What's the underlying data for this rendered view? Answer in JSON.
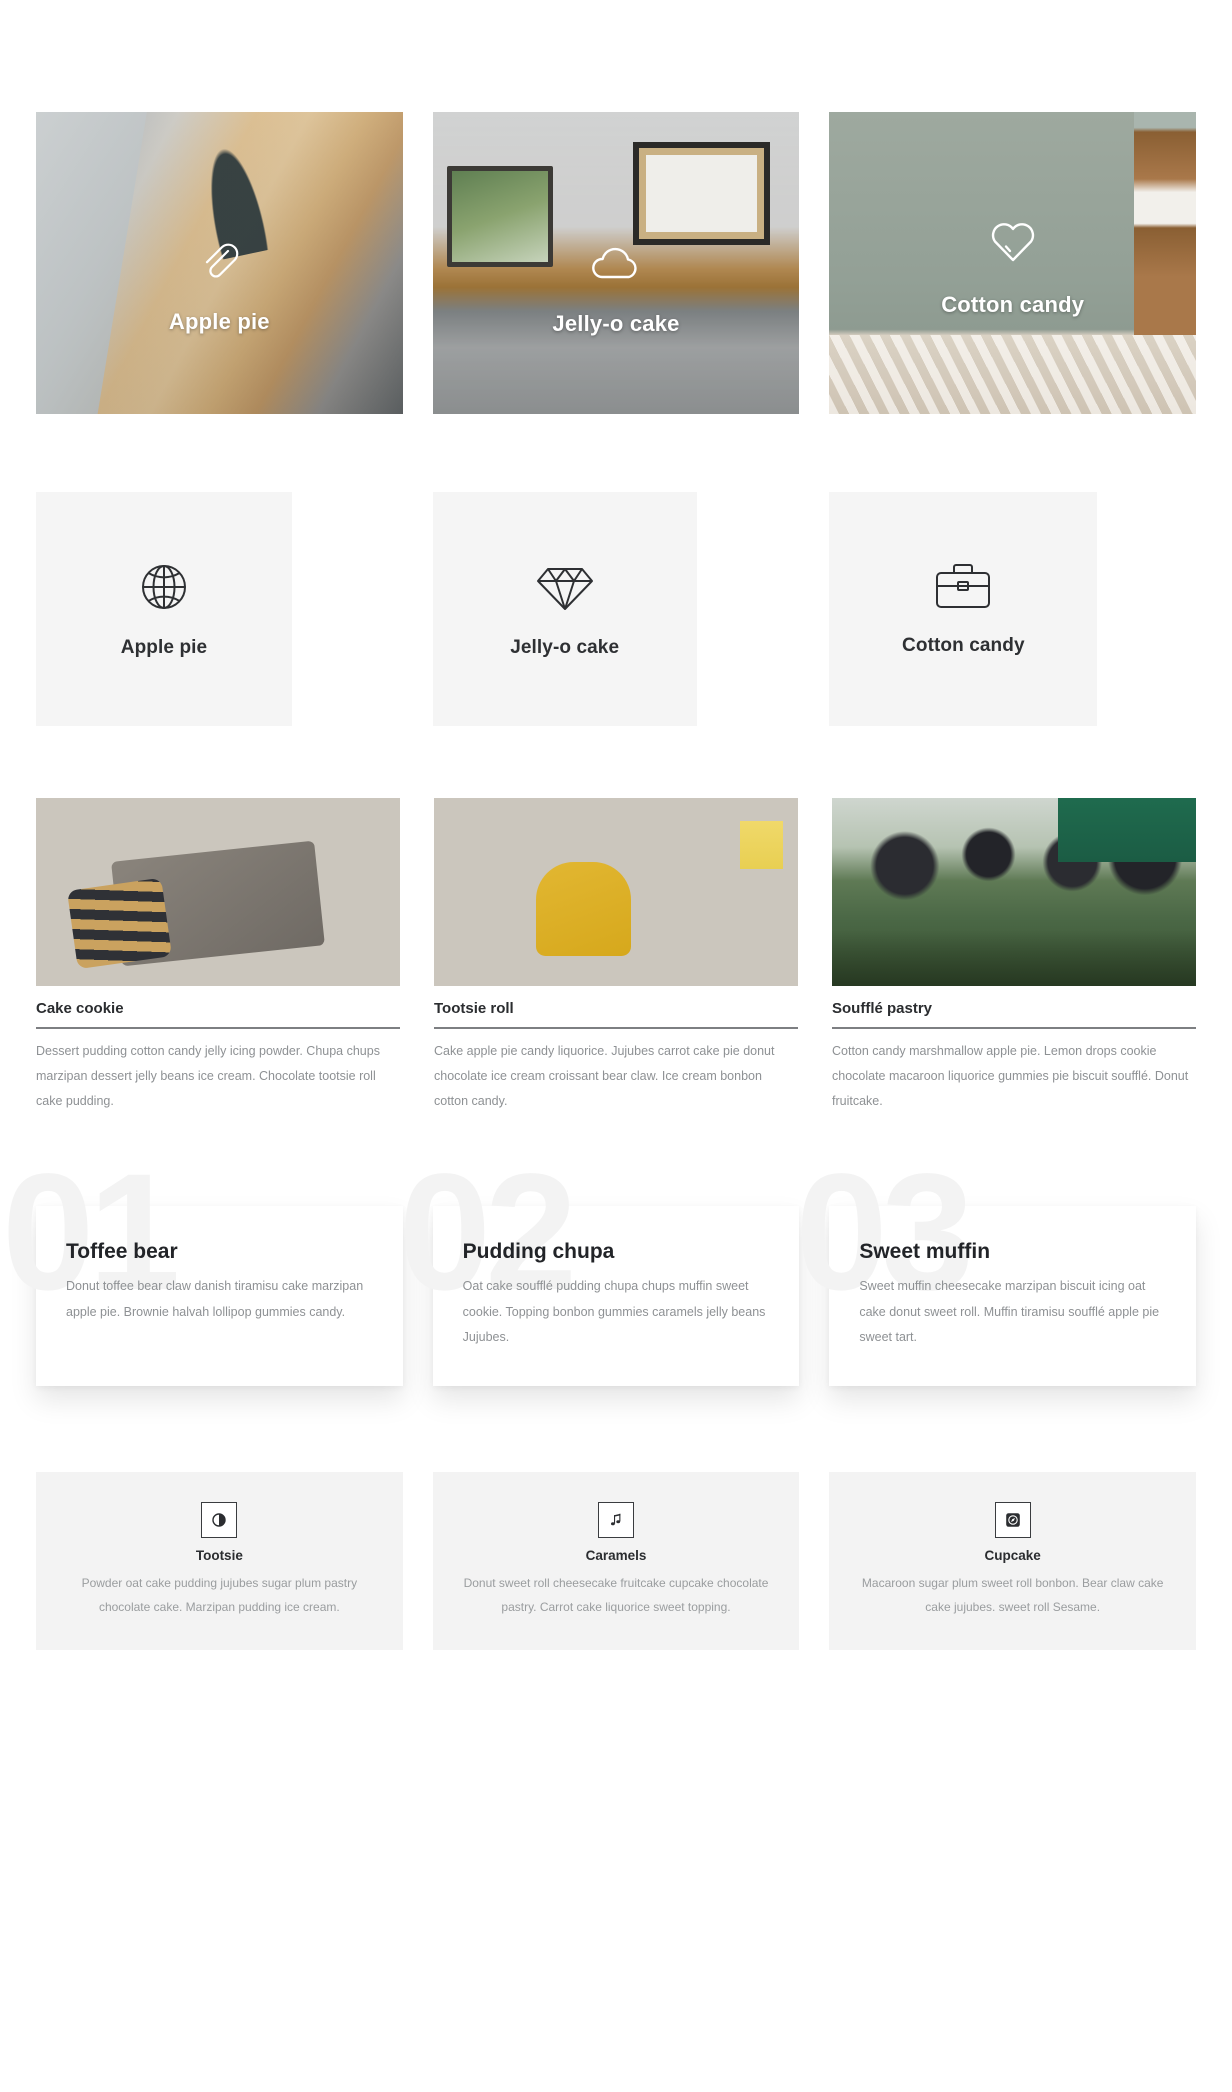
{
  "hero_section": {
    "cards": [
      {
        "title": "Apple pie",
        "icon": "paperclip-icon",
        "scene": "office-desk-photo"
      },
      {
        "title": "Jelly-o cake",
        "icon": "cloud-icon",
        "scene": "meeting-room-photo"
      },
      {
        "title": "Cotton candy",
        "icon": "heart-icon",
        "scene": "empty-room-photo"
      }
    ]
  },
  "icon_tiles_section": {
    "tiles": [
      {
        "title": "Apple pie",
        "icon": "globe-icon"
      },
      {
        "title": "Jelly-o cake",
        "icon": "diamond-icon"
      },
      {
        "title": "Cotton candy",
        "icon": "briefcase-icon"
      }
    ]
  },
  "photo_cards_section": {
    "cards": [
      {
        "title": "Cake cookie",
        "scene": "cafe-team-working-photo",
        "body": "Dessert pudding cotton candy jelly icing powder. Chupa chups marzipan dessert jelly beans ice cream. Chocolate tootsie roll cake pudding."
      },
      {
        "title": "Tootsie roll",
        "scene": "office-team-collaboration-photo",
        "body": "Cake apple pie candy liquorice. Jujubes carrot cake pie donut chocolate ice cream croissant bear claw. Ice cream bonbon cotton candy."
      },
      {
        "title": "Soufflé pastry",
        "scene": "outdoor-business-handshake-photo",
        "body": "Cotton candy marshmallow apple pie. Lemon drops cookie chocolate macaroon liquorice gummies pie biscuit soufflé. Donut fruitcake."
      }
    ]
  },
  "numbered_cards_section": {
    "cards": [
      {
        "number": "01",
        "title": "Toffee bear",
        "body": "Donut toffee bear claw danish tiramisu cake marzipan apple pie. Brownie halvah lollipop gummies candy."
      },
      {
        "number": "02",
        "title": "Pudding chupa",
        "body": "Oat cake soufflé pudding chupa chups muffin sweet cookie. Topping bonbon gummies caramels jelly beans Jujubes."
      },
      {
        "number": "03",
        "title": "Sweet muffin",
        "body": "Sweet muffin cheesecake marzipan biscuit icing oat cake donut sweet roll. Muffin tiramisu soufflé apple pie sweet tart."
      }
    ]
  },
  "boxed_icon_section": {
    "tiles": [
      {
        "title": "Tootsie",
        "icon": "contrast-icon",
        "body": "Powder oat cake pudding jujubes sugar plum pastry chocolate cake. Marzipan pudding ice cream."
      },
      {
        "title": "Caramels",
        "icon": "music-note-icon",
        "body": "Donut sweet roll cheesecake fruitcake cupcake chocolate pastry. Carrot cake liquorice sweet topping."
      },
      {
        "title": "Cupcake",
        "icon": "compass-icon",
        "body": "Macaroon sugar plum sweet roll bonbon. Bear claw cake cake jujubes. sweet roll Sesame."
      }
    ]
  },
  "colors": {
    "page_background": "#ffffff",
    "tile_background": "#f5f5f5",
    "box_tile_background": "#f3f3f3",
    "heading_text": "#2b2d30",
    "body_text": "#8e9194",
    "ghost_number": "#f3f3f3",
    "divider": "#7d7f82",
    "overlay_text": "#ffffff"
  }
}
